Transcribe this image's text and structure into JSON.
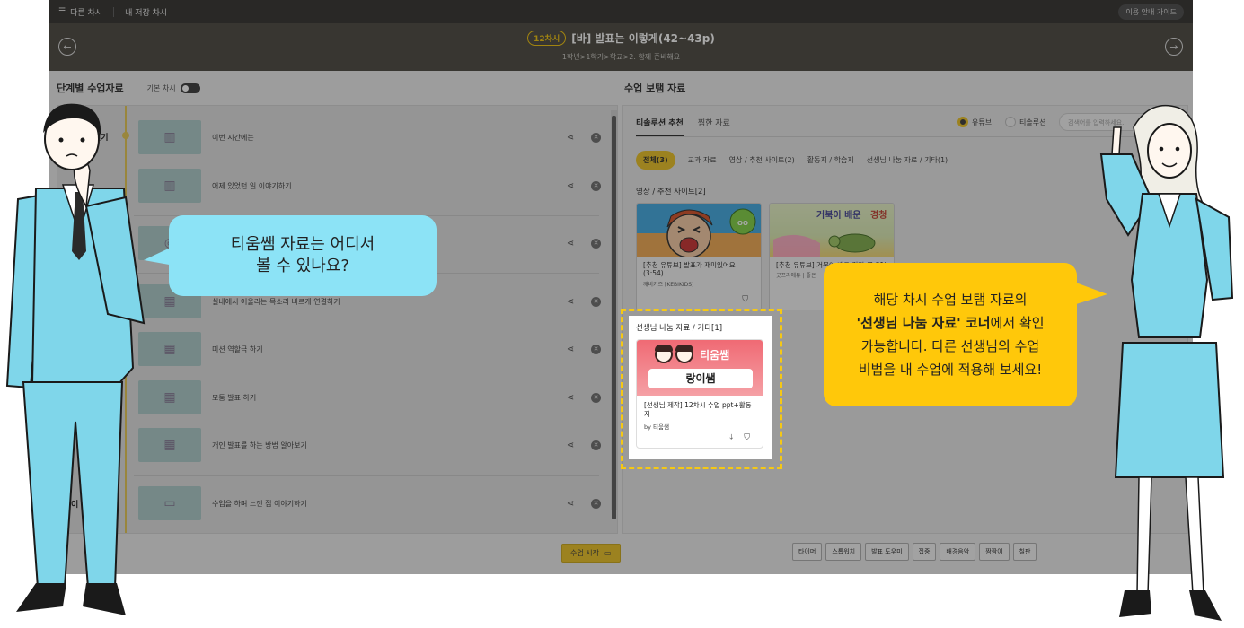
{
  "topbar": {
    "other_lessons": "다른 차시",
    "my_saved": "내 저장 차시",
    "guide": "이용 안내 가이드"
  },
  "lesson": {
    "badge": "12차시",
    "title": "[바] 발표는 이렇게(42~43p)",
    "path": "1학년>1학기>학교>2. 함께 준비해요"
  },
  "left": {
    "heading": "단계별 수업자료",
    "toggle_label": "기본 차시",
    "stage_open": "열기",
    "stage_close": "이",
    "rows": [
      {
        "label": "이번 시간에는",
        "icon": "book-icon"
      },
      {
        "label": "어제 있었던 일 이야기하기",
        "icon": "book-icon"
      },
      {
        "label": "",
        "icon": "target-icon"
      },
      {
        "label": "실내에서 어울리는 목소리 바르게 연결하기",
        "icon": "book-open-icon"
      },
      {
        "label": "미션 역할극 하기",
        "icon": "book-open-icon"
      },
      {
        "label": "모둠 발표 하기",
        "icon": "book-open-icon"
      },
      {
        "label": "개인 발표를 하는 방법 알아보기",
        "icon": "book-open-icon"
      },
      {
        "label": "수업을 하며 느낀 점 이야기하기",
        "icon": "laptop-icon"
      }
    ],
    "start_button": "수업 시작"
  },
  "right": {
    "heading": "수업 보탬 자료",
    "tabs": [
      "티솔루션 추천",
      "찜한 자료"
    ],
    "sources": [
      "유튜브",
      "티솔루션"
    ],
    "search_placeholder": "검색어를 입력하세요.",
    "filters": [
      "전체(3)",
      "교과 자료",
      "영상 / 추천 사이트(2)",
      "활동지 / 학습지",
      "선생님 나눔 자료 / 기타(1)"
    ],
    "video_section": "영상 / 추천 사이트[2]",
    "videos": [
      {
        "caption": "[추천 유튜브] 발표가 재미있어요 (3:54)",
        "source": "깨비키즈 [KEBIKIDS]"
      },
      {
        "caption": "[추천 유튜브] 거북이 배운 경청 (2:31)",
        "source": "굿프라에듀 | 좋은"
      }
    ],
    "teacher_section": "선생님 나눔 자료 / 기타[1]",
    "teacher_card": {
      "brand": "티움쌤",
      "pill": "랑이쌤",
      "caption": "[선생님 제작] 12차시 수업 ppt+활동지",
      "by": "by 티움쌤"
    },
    "tools": [
      "타이머",
      "스톱워치",
      "발표 도우미",
      "집중",
      "배경음악",
      "짬짬이",
      "칠판"
    ]
  },
  "bubbles": {
    "question_line1": "티움쌤 자료는 어디서",
    "question_line2": "볼 수 있나요?",
    "answer_line1": "해당 차시 수업 보탬 자료의",
    "answer_bold": "'선생님 나눔 자료' 코너",
    "answer_line2_rest": "에서 확인",
    "answer_line3": "가능합니다. 다른 선생님의 수업",
    "answer_line4": "비법을 내 수업에 적용해 보세요!"
  },
  "colors": {
    "accent": "#e9bf1b",
    "bubble_blue": "#8ce3f6",
    "bubble_yellow": "#ffc80a",
    "suit": "#7fd6ea"
  }
}
